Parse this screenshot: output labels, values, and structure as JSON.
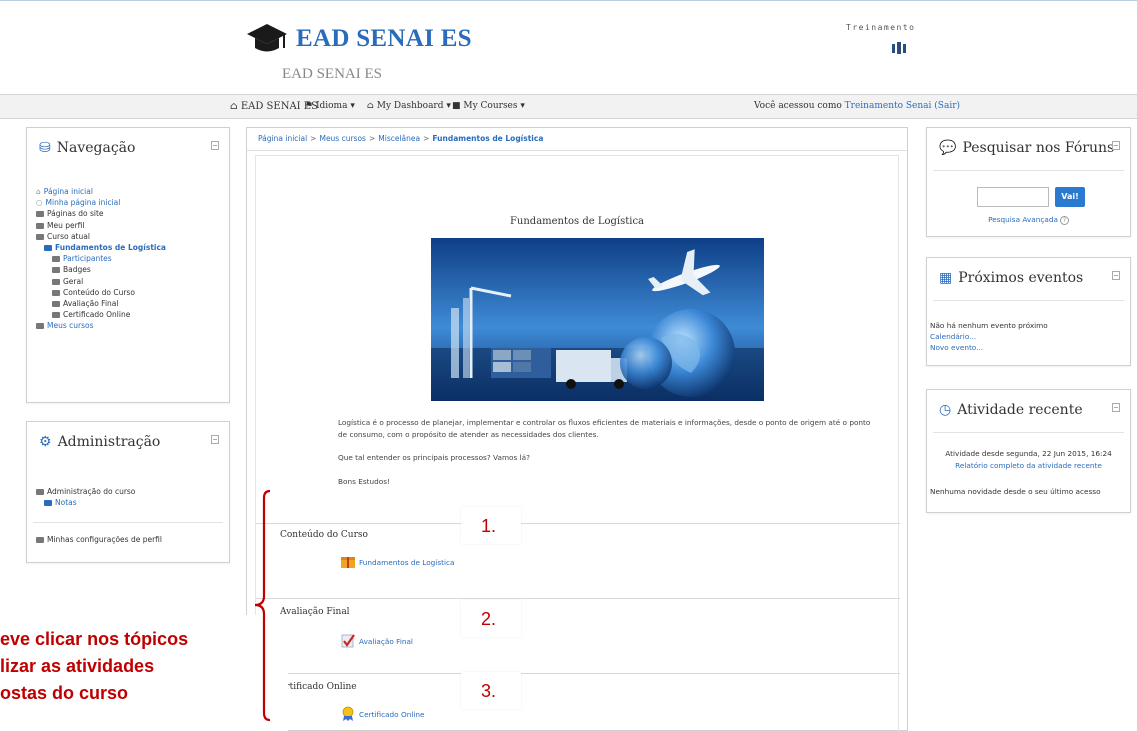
{
  "header": {
    "logo_text": "EAD SENAI ES",
    "site_subtitle": "EAD SENAI ES",
    "user_name": "Treinamento"
  },
  "navbar": {
    "brand": "EAD SENAI ES",
    "language": "Idioma",
    "dashboard": "My Dashboard",
    "courses": "My Courses",
    "login_prefix": "Você acessou como",
    "login_user": "Treinamento Senai",
    "logout": "(Sair)"
  },
  "navigation": {
    "title": "Navegação",
    "items": [
      {
        "label": "Página inicial"
      },
      {
        "label": "Minha página inicial"
      },
      {
        "label": "Páginas do site"
      },
      {
        "label": "Meu perfil"
      },
      {
        "label": "Curso atual"
      },
      {
        "label": "Fundamentos de Logística"
      },
      {
        "label": "Participantes"
      },
      {
        "label": "Badges"
      },
      {
        "label": "Geral"
      },
      {
        "label": "Conteúdo do Curso"
      },
      {
        "label": "Avaliação Final"
      },
      {
        "label": "Certificado Online"
      },
      {
        "label": "Meus cursos"
      }
    ]
  },
  "administration": {
    "title": "Administração",
    "items": [
      {
        "label": "Administração do curso"
      },
      {
        "label": "Notas"
      },
      {
        "label": "Minhas configurações de perfil"
      }
    ]
  },
  "breadcrumb": {
    "items": [
      "Página inicial",
      "Meus cursos",
      "Miscelânea",
      "Fundamentos de Logística"
    ],
    "separator": ">"
  },
  "course": {
    "heading": "Fundamentos de Logística",
    "paragraphs": [
      "Logística é o processo de planejar, implementar e controlar os fluxos eficientes de materiais e informações, desde o ponto de origem até o ponto de consumo, com o propósito de atender as necessidades dos clientes.",
      "Que tal entender os principais processos? Vamos lá?",
      "Bons Estudos!"
    ],
    "sections": [
      {
        "title": "Conteúdo do Curso",
        "activity": "Fundamentos de Logística",
        "number": "1."
      },
      {
        "title": "Avaliação Final",
        "activity": "Avaliação Final",
        "number": "2."
      },
      {
        "title": "ertificado Online",
        "activity": "Certificado Online",
        "number": "3."
      }
    ]
  },
  "annotation": {
    "lines": [
      "eve clicar nos tópicos",
      "lizar as atividades",
      "ostas do curso"
    ],
    "color": "#c00000"
  },
  "forum_search": {
    "title": "Pesquisar nos Fóruns",
    "button": "Vai!",
    "advanced": "Pesquisa Avançada",
    "help": "?"
  },
  "events": {
    "title": "Próximos eventos",
    "none": "Não há nenhum evento próximo",
    "calendar": "Calendário...",
    "new_event": "Novo evento..."
  },
  "recent": {
    "title": "Atividade recente",
    "since": "Atividade desde segunda, 22 Jun 2015, 16:24",
    "full_report": "Relatório completo da atividade recente",
    "nothing": "Nenhuma novidade desde o seu último acesso"
  },
  "colors": {
    "link": "#2a6cbc",
    "accent_red": "#c00000",
    "button_blue": "#2a7bd0"
  },
  "icons": {
    "logo": "graduation-cap-icon",
    "home": "home-icon",
    "folder": "folder-icon",
    "search": "comments-icon",
    "calendar": "calendar-icon",
    "clock": "clock-icon",
    "gears": "gears-icon",
    "sitemap": "sitemap-icon"
  }
}
